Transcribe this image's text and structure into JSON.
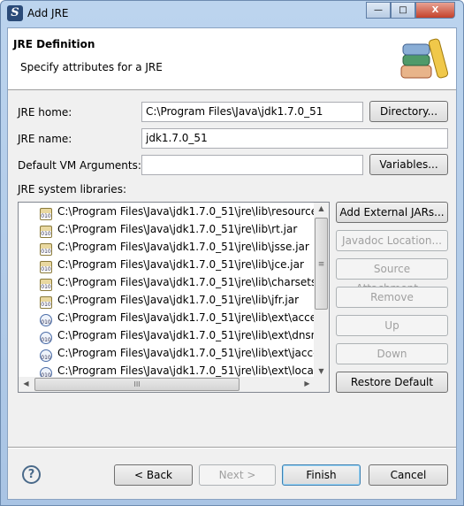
{
  "window": {
    "title": "Add JRE",
    "minimize": "—",
    "maximize": "□",
    "close": "X"
  },
  "header": {
    "title": "JRE Definition",
    "subtitle": "Specify attributes for a JRE"
  },
  "form": {
    "jre_home_label": "JRE home:",
    "jre_home_value": "C:\\Program Files\\Java\\jdk1.7.0_51",
    "directory_button": "Directory...",
    "jre_name_label": "JRE name:",
    "jre_name_value": "jdk1.7.0_51",
    "vm_args_label": "Default VM Arguments:",
    "vm_args_value": "",
    "variables_button": "Variables...",
    "libraries_label": "JRE system libraries:"
  },
  "libraries": [
    {
      "path": "C:\\Program Files\\Java\\jdk1.7.0_51\\jre\\lib\\resources",
      "icon": "jar-icon"
    },
    {
      "path": "C:\\Program Files\\Java\\jdk1.7.0_51\\jre\\lib\\rt.jar",
      "icon": "jar-icon"
    },
    {
      "path": "C:\\Program Files\\Java\\jdk1.7.0_51\\jre\\lib\\jsse.jar",
      "icon": "jar-icon"
    },
    {
      "path": "C:\\Program Files\\Java\\jdk1.7.0_51\\jre\\lib\\jce.jar",
      "icon": "jar-icon"
    },
    {
      "path": "C:\\Program Files\\Java\\jdk1.7.0_51\\jre\\lib\\charsets.",
      "icon": "jar-icon"
    },
    {
      "path": "C:\\Program Files\\Java\\jdk1.7.0_51\\jre\\lib\\jfr.jar",
      "icon": "jar-icon"
    },
    {
      "path": "C:\\Program Files\\Java\\jdk1.7.0_51\\jre\\lib\\ext\\acces",
      "icon": "ext-jar-icon"
    },
    {
      "path": "C:\\Program Files\\Java\\jdk1.7.0_51\\jre\\lib\\ext\\dnsn",
      "icon": "ext-jar-icon"
    },
    {
      "path": "C:\\Program Files\\Java\\jdk1.7.0_51\\jre\\lib\\ext\\jacce",
      "icon": "ext-jar-icon"
    },
    {
      "path": "C:\\Program Files\\Java\\jdk1.7.0_51\\jre\\lib\\ext\\local",
      "icon": "ext-jar-icon"
    }
  ],
  "side_buttons": [
    {
      "label": "Add External JARs...",
      "enabled": true
    },
    {
      "label": "Javadoc Location...",
      "enabled": false
    },
    {
      "label": "Source Attachment...",
      "enabled": false
    },
    {
      "label": "Remove",
      "enabled": false
    },
    {
      "label": "Up",
      "enabled": false
    },
    {
      "label": "Down",
      "enabled": false
    },
    {
      "label": "Restore Default",
      "enabled": true
    }
  ],
  "footer": {
    "help": "?",
    "back": "< Back",
    "next": "Next >",
    "finish": "Finish",
    "cancel": "Cancel"
  }
}
